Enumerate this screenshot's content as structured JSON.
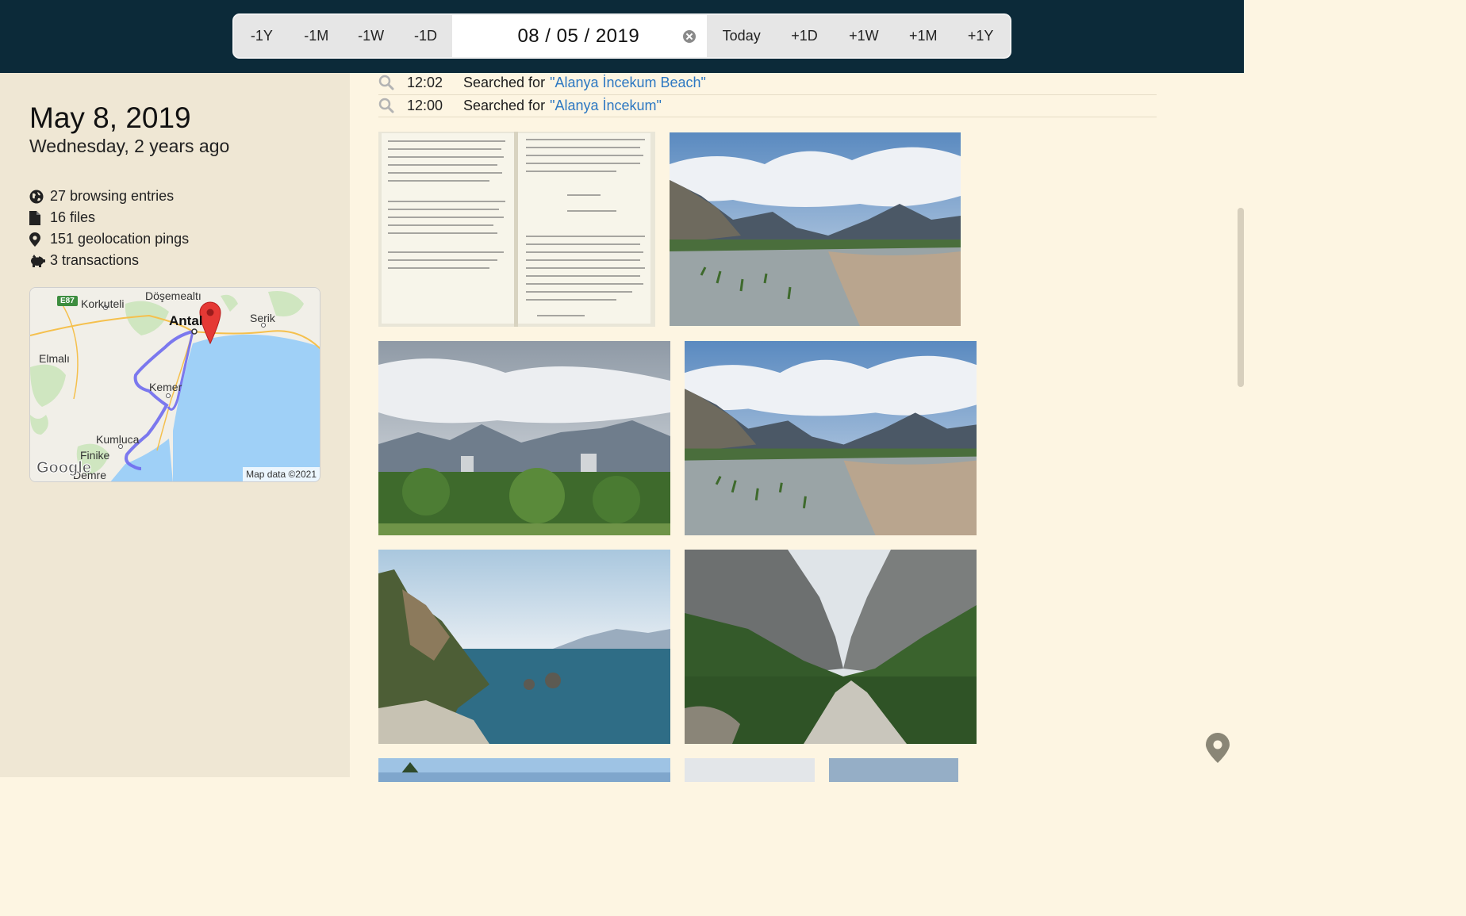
{
  "datebar": {
    "back_buttons": [
      "-1Y",
      "-1M",
      "-1W",
      "-1D"
    ],
    "date_value": "08 / 05 / 2019",
    "forward_buttons": [
      "Today",
      "+1D",
      "+1W",
      "+1M",
      "+1Y"
    ]
  },
  "sidebar": {
    "title": "May 8, 2019",
    "subtitle": "Wednesday, 2 years ago",
    "stats": [
      {
        "icon": "globe-icon",
        "text": "27 browsing entries"
      },
      {
        "icon": "file-icon",
        "text": "16 files"
      },
      {
        "icon": "map-pin-icon",
        "text": "151 geolocation pings"
      },
      {
        "icon": "piggy-bank-icon",
        "text": "3 transactions"
      }
    ],
    "map": {
      "labels": [
        "Döşemealtı",
        "Korkuteli",
        "Antalya",
        "Serik",
        "Elmalı",
        "Kemer",
        "Kumluca",
        "Finike",
        "Demre"
      ],
      "road_badge": "E87",
      "google_logo": "Google",
      "credit": "Map data ©2021"
    }
  },
  "timeline": {
    "searches": [
      {
        "time": "12:02",
        "prefix": "Searched for",
        "query": "\"Alanya İncekum Beach\""
      },
      {
        "time": "12:00",
        "prefix": "Searched for",
        "query": "\"Alanya İncekum\""
      }
    ],
    "photos": [
      {
        "subject": "handwritten journal pages"
      },
      {
        "subject": "river delta with mountains"
      },
      {
        "subject": "city skyline with mountains"
      },
      {
        "subject": "river delta with mountains"
      },
      {
        "subject": "coastal cliff and sea"
      },
      {
        "subject": "canyon with river"
      }
    ]
  },
  "colors": {
    "topbar": "#0c2a39",
    "sidebar": "#efe7d4",
    "main_bg": "#fdf5e2",
    "link": "#2d78c2"
  }
}
